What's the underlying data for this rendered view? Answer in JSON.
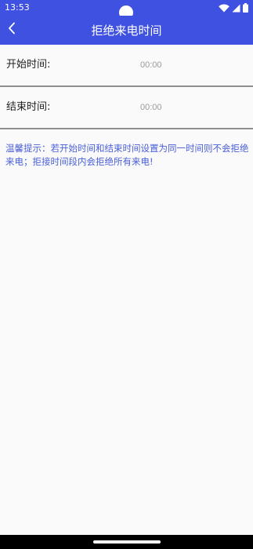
{
  "status_bar": {
    "time": "13:53",
    "icons": [
      "wifi-icon",
      "signal-icon",
      "battery-icon"
    ]
  },
  "app_bar": {
    "title": "拒绝来电时间",
    "back_icon": "chevron-left-icon"
  },
  "start_time": {
    "label": "开始时间:",
    "value": "00:00"
  },
  "end_time": {
    "label": "结束时间:",
    "value": "00:00"
  },
  "tip": {
    "text": "温馨提示：若开始时间和结束时间设置为同一时间则不会拒绝来电；拒接时间段内会拒绝所有来电!"
  },
  "colors": {
    "primary": "#3f51e0",
    "tip_text": "#4a5fd8",
    "divider": "#8e8e8e",
    "background": "#fafafa"
  }
}
